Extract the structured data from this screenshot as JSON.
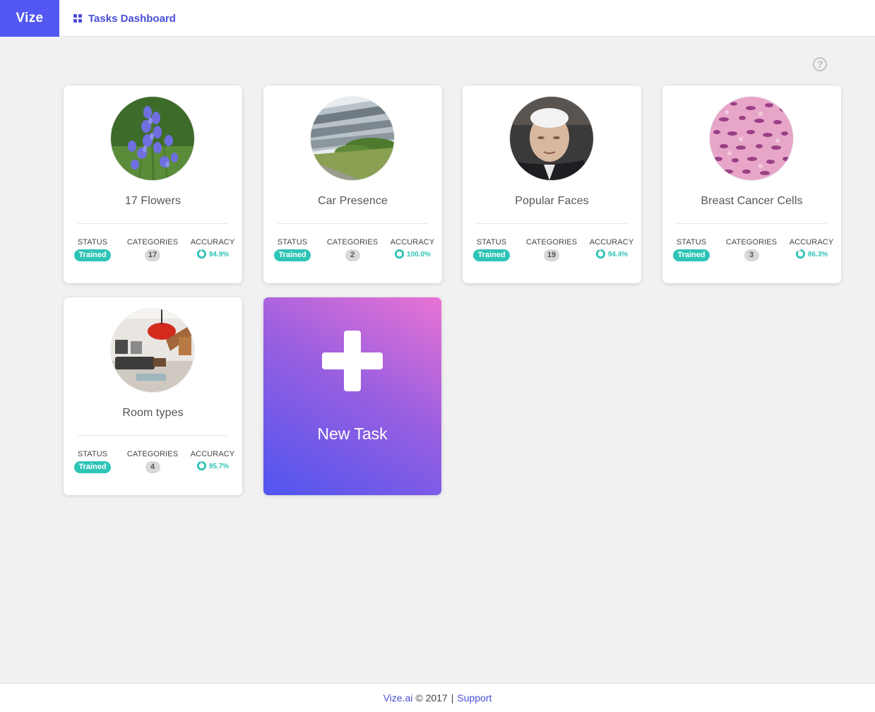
{
  "header": {
    "brand": "Vize",
    "nav_label": "Tasks Dashboard"
  },
  "help_icon": "?",
  "labels": {
    "status": "STATUS",
    "categories": "CATEGORIES",
    "accuracy": "ACCURACY"
  },
  "tasks": [
    {
      "name": "17 Flowers",
      "status": "Trained",
      "categories": "17",
      "accuracy": "94.9%",
      "accuracy_fraction": 0.949
    },
    {
      "name": "Car Presence",
      "status": "Trained",
      "categories": "2",
      "accuracy": "100.0%",
      "accuracy_fraction": 1.0
    },
    {
      "name": "Popular Faces",
      "status": "Trained",
      "categories": "19",
      "accuracy": "94.4%",
      "accuracy_fraction": 0.944
    },
    {
      "name": "Breast Cancer Cells",
      "status": "Trained",
      "categories": "3",
      "accuracy": "86.3%",
      "accuracy_fraction": 0.863
    },
    {
      "name": "Room types",
      "status": "Trained",
      "categories": "4",
      "accuracy": "95.7%",
      "accuracy_fraction": 0.957
    }
  ],
  "new_task": {
    "label": "New Task"
  },
  "footer": {
    "brand_link": "Vize.ai",
    "copyright": "© 2017",
    "separator": "|",
    "support_link": "Support"
  },
  "colors": {
    "brand": "#5157f0",
    "accent": "#2ec4b6",
    "link": "#4a4fd6"
  }
}
